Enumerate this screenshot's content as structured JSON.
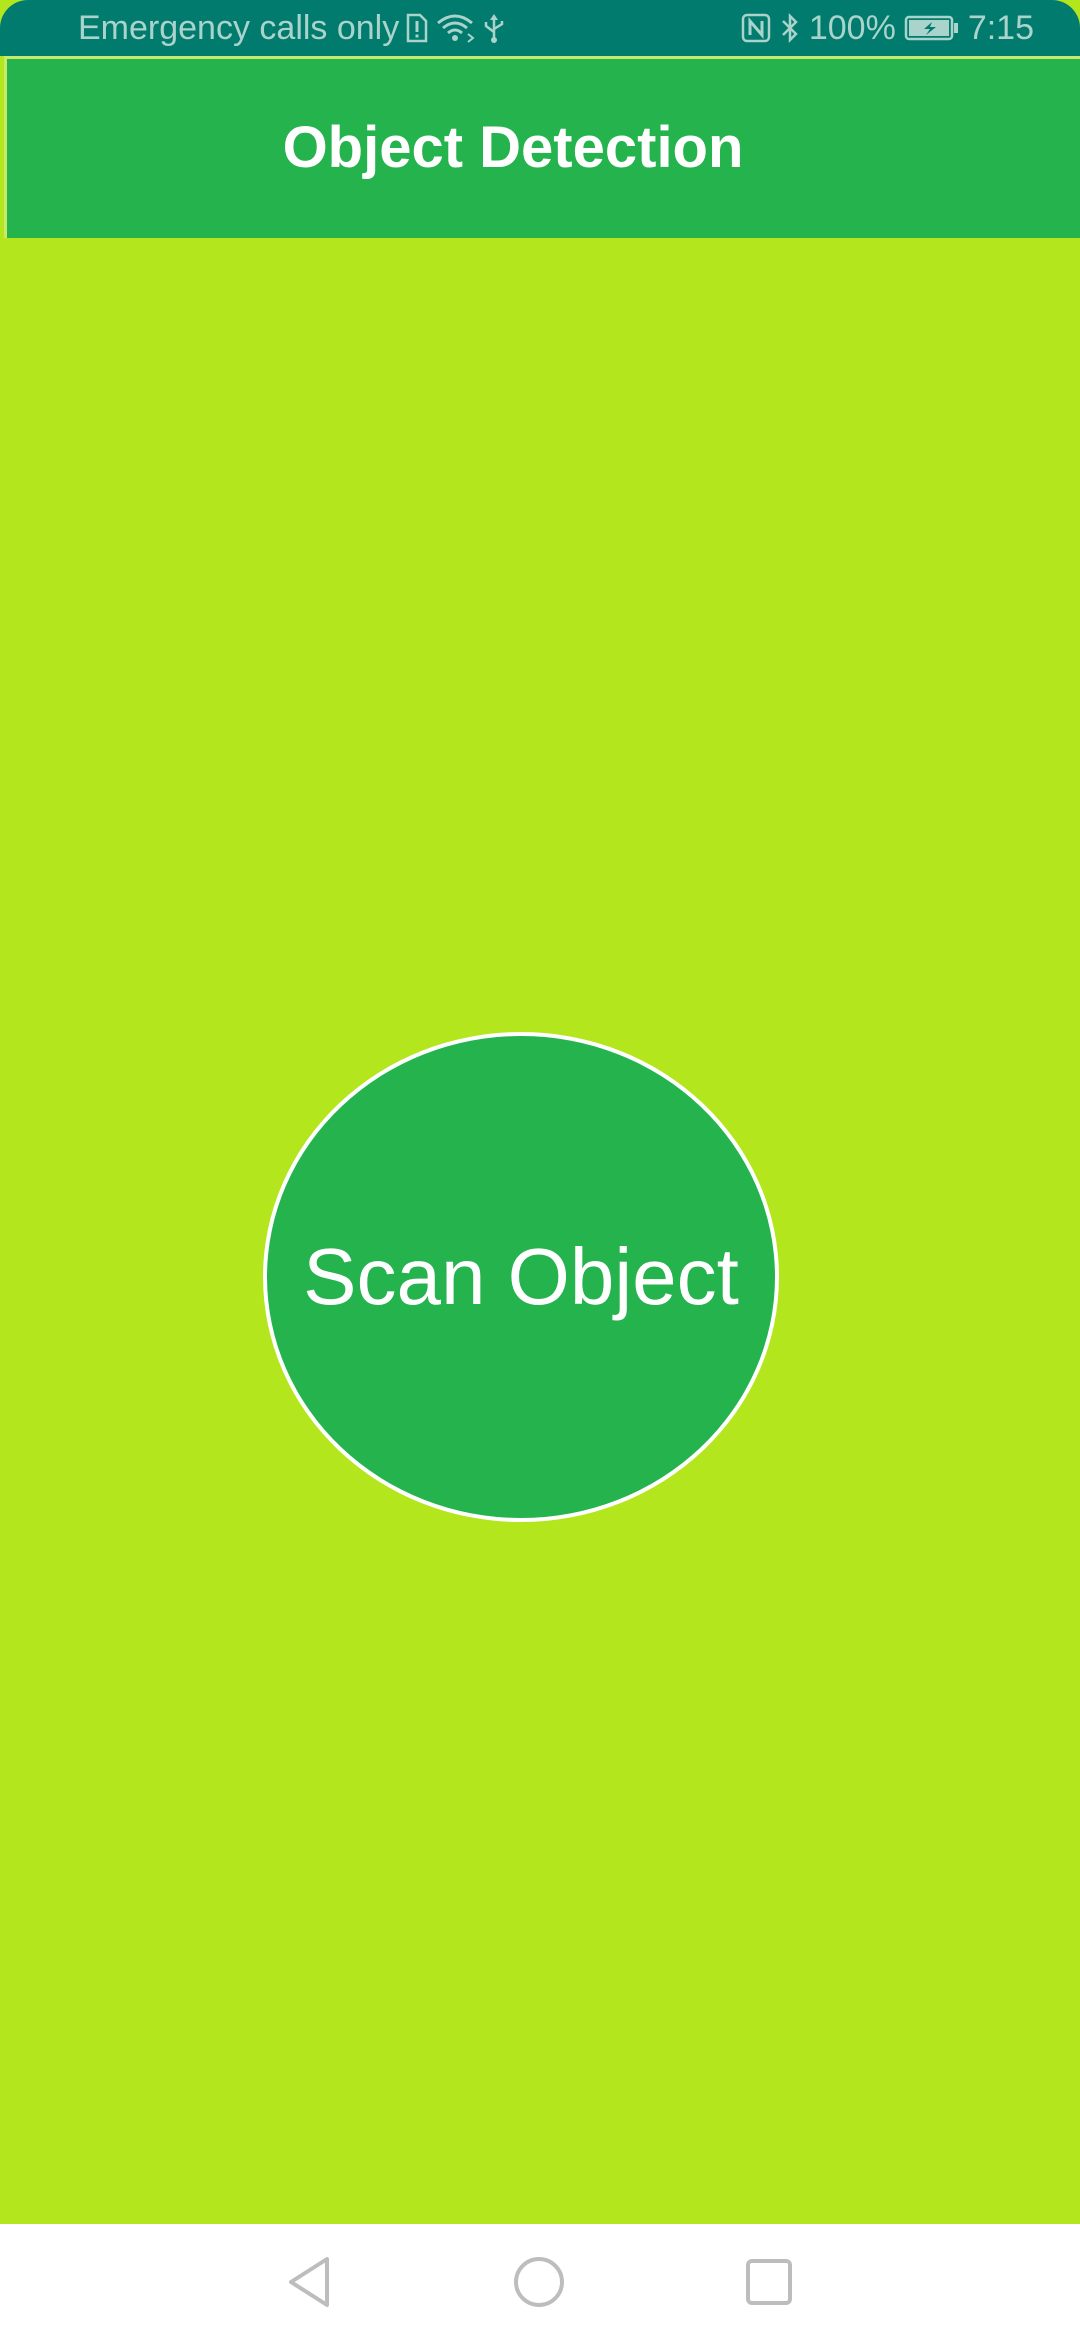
{
  "status_bar": {
    "carrier_text": "Emergency calls only",
    "battery_percent": "100%",
    "time": "7:15",
    "icons": [
      "sim-alert-icon",
      "wifi-icon",
      "usb-icon",
      "nfc-icon",
      "bluetooth-icon",
      "battery-charging-icon"
    ]
  },
  "app_bar": {
    "title": "Object Detection"
  },
  "main": {
    "scan_button_label": "Scan Object"
  },
  "nav_bar": {
    "icons": [
      "back-icon",
      "home-icon",
      "recent-apps-icon"
    ]
  },
  "colors": {
    "status_bar_bg": "#017B6D",
    "app_bar_bg": "#24B34C",
    "page_bg": "#B4E61E",
    "button_bg": "#24B34C",
    "button_border": "#FFFFFF",
    "nav_bar_bg": "#FFFFFF"
  }
}
